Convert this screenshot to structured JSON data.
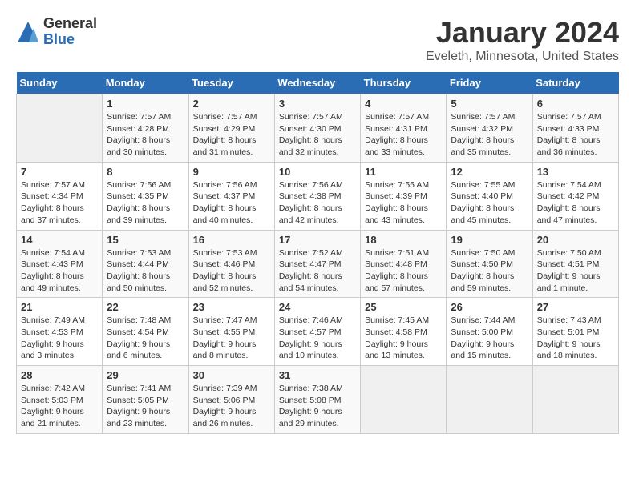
{
  "logo": {
    "general": "General",
    "blue": "Blue"
  },
  "header": {
    "title": "January 2024",
    "subtitle": "Eveleth, Minnesota, United States"
  },
  "days_of_week": [
    "Sunday",
    "Monday",
    "Tuesday",
    "Wednesday",
    "Thursday",
    "Friday",
    "Saturday"
  ],
  "weeks": [
    [
      {
        "day": "",
        "info": ""
      },
      {
        "day": "1",
        "info": "Sunrise: 7:57 AM\nSunset: 4:28 PM\nDaylight: 8 hours\nand 30 minutes."
      },
      {
        "day": "2",
        "info": "Sunrise: 7:57 AM\nSunset: 4:29 PM\nDaylight: 8 hours\nand 31 minutes."
      },
      {
        "day": "3",
        "info": "Sunrise: 7:57 AM\nSunset: 4:30 PM\nDaylight: 8 hours\nand 32 minutes."
      },
      {
        "day": "4",
        "info": "Sunrise: 7:57 AM\nSunset: 4:31 PM\nDaylight: 8 hours\nand 33 minutes."
      },
      {
        "day": "5",
        "info": "Sunrise: 7:57 AM\nSunset: 4:32 PM\nDaylight: 8 hours\nand 35 minutes."
      },
      {
        "day": "6",
        "info": "Sunrise: 7:57 AM\nSunset: 4:33 PM\nDaylight: 8 hours\nand 36 minutes."
      }
    ],
    [
      {
        "day": "7",
        "info": "Sunrise: 7:57 AM\nSunset: 4:34 PM\nDaylight: 8 hours\nand 37 minutes."
      },
      {
        "day": "8",
        "info": "Sunrise: 7:56 AM\nSunset: 4:35 PM\nDaylight: 8 hours\nand 39 minutes."
      },
      {
        "day": "9",
        "info": "Sunrise: 7:56 AM\nSunset: 4:37 PM\nDaylight: 8 hours\nand 40 minutes."
      },
      {
        "day": "10",
        "info": "Sunrise: 7:56 AM\nSunset: 4:38 PM\nDaylight: 8 hours\nand 42 minutes."
      },
      {
        "day": "11",
        "info": "Sunrise: 7:55 AM\nSunset: 4:39 PM\nDaylight: 8 hours\nand 43 minutes."
      },
      {
        "day": "12",
        "info": "Sunrise: 7:55 AM\nSunset: 4:40 PM\nDaylight: 8 hours\nand 45 minutes."
      },
      {
        "day": "13",
        "info": "Sunrise: 7:54 AM\nSunset: 4:42 PM\nDaylight: 8 hours\nand 47 minutes."
      }
    ],
    [
      {
        "day": "14",
        "info": "Sunrise: 7:54 AM\nSunset: 4:43 PM\nDaylight: 8 hours\nand 49 minutes."
      },
      {
        "day": "15",
        "info": "Sunrise: 7:53 AM\nSunset: 4:44 PM\nDaylight: 8 hours\nand 50 minutes."
      },
      {
        "day": "16",
        "info": "Sunrise: 7:53 AM\nSunset: 4:46 PM\nDaylight: 8 hours\nand 52 minutes."
      },
      {
        "day": "17",
        "info": "Sunrise: 7:52 AM\nSunset: 4:47 PM\nDaylight: 8 hours\nand 54 minutes."
      },
      {
        "day": "18",
        "info": "Sunrise: 7:51 AM\nSunset: 4:48 PM\nDaylight: 8 hours\nand 57 minutes."
      },
      {
        "day": "19",
        "info": "Sunrise: 7:50 AM\nSunset: 4:50 PM\nDaylight: 8 hours\nand 59 minutes."
      },
      {
        "day": "20",
        "info": "Sunrise: 7:50 AM\nSunset: 4:51 PM\nDaylight: 9 hours\nand 1 minute."
      }
    ],
    [
      {
        "day": "21",
        "info": "Sunrise: 7:49 AM\nSunset: 4:53 PM\nDaylight: 9 hours\nand 3 minutes."
      },
      {
        "day": "22",
        "info": "Sunrise: 7:48 AM\nSunset: 4:54 PM\nDaylight: 9 hours\nand 6 minutes."
      },
      {
        "day": "23",
        "info": "Sunrise: 7:47 AM\nSunset: 4:55 PM\nDaylight: 9 hours\nand 8 minutes."
      },
      {
        "day": "24",
        "info": "Sunrise: 7:46 AM\nSunset: 4:57 PM\nDaylight: 9 hours\nand 10 minutes."
      },
      {
        "day": "25",
        "info": "Sunrise: 7:45 AM\nSunset: 4:58 PM\nDaylight: 9 hours\nand 13 minutes."
      },
      {
        "day": "26",
        "info": "Sunrise: 7:44 AM\nSunset: 5:00 PM\nDaylight: 9 hours\nand 15 minutes."
      },
      {
        "day": "27",
        "info": "Sunrise: 7:43 AM\nSunset: 5:01 PM\nDaylight: 9 hours\nand 18 minutes."
      }
    ],
    [
      {
        "day": "28",
        "info": "Sunrise: 7:42 AM\nSunset: 5:03 PM\nDaylight: 9 hours\nand 21 minutes."
      },
      {
        "day": "29",
        "info": "Sunrise: 7:41 AM\nSunset: 5:05 PM\nDaylight: 9 hours\nand 23 minutes."
      },
      {
        "day": "30",
        "info": "Sunrise: 7:39 AM\nSunset: 5:06 PM\nDaylight: 9 hours\nand 26 minutes."
      },
      {
        "day": "31",
        "info": "Sunrise: 7:38 AM\nSunset: 5:08 PM\nDaylight: 9 hours\nand 29 minutes."
      },
      {
        "day": "",
        "info": ""
      },
      {
        "day": "",
        "info": ""
      },
      {
        "day": "",
        "info": ""
      }
    ]
  ]
}
